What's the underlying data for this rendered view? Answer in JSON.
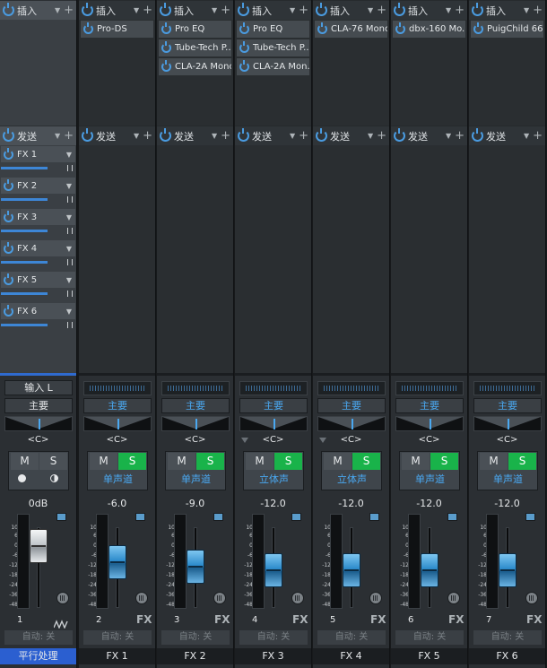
{
  "header_labels": {
    "insert": "插入",
    "send": "发送"
  },
  "scale_labels": [
    "10",
    "6",
    "0",
    "-6",
    "-12",
    "-18",
    "-24",
    "-36",
    "-48"
  ],
  "channels": [
    {
      "id": "ch1",
      "input": "输入 L",
      "output": "主要",
      "pan": "<C>",
      "mute": "M",
      "solo": "S",
      "solo_active": false,
      "route": "",
      "volume": "0dB",
      "number": "1",
      "name": "平行处理",
      "automation": "自动: 关",
      "fx_label": "",
      "fader_level": 1.0,
      "inserts": [],
      "sends": [
        "FX 1",
        "FX 2",
        "FX 3",
        "FX 4",
        "FX 5",
        "FX 6"
      ]
    },
    {
      "id": "ch2",
      "input": "",
      "output": "主要",
      "pan": "<C>",
      "mute": "M",
      "solo": "S",
      "solo_active": true,
      "route": "单声道",
      "volume": "-6.0",
      "number": "2",
      "name": "FX 1",
      "automation": "自动: 关",
      "fx_label": "FX",
      "fader_level": 0.6,
      "inserts": [
        "Pro-DS"
      ],
      "sends": []
    },
    {
      "id": "ch3",
      "input": "",
      "output": "主要",
      "pan": "<C>",
      "mute": "M",
      "solo": "S",
      "solo_active": true,
      "route": "单声道",
      "volume": "-9.0",
      "number": "3",
      "name": "FX 2",
      "automation": "自动: 关",
      "fx_label": "FX",
      "fader_level": 0.5,
      "inserts": [
        "Pro EQ",
        "Tube-Tech P...",
        "CLA-2A Mono"
      ],
      "sends": []
    },
    {
      "id": "ch4",
      "input": "",
      "output": "主要",
      "pan": "<C>",
      "mute": "M",
      "solo": "S",
      "solo_active": true,
      "route": "立体声",
      "volume": "-12.0",
      "number": "4",
      "name": "FX 3",
      "automation": "自动: 关",
      "fx_label": "FX",
      "fader_level": 0.42,
      "inserts": [
        "Pro EQ",
        "Tube-Tech P...",
        "CLA-2A Mon..."
      ],
      "sends": []
    },
    {
      "id": "ch5",
      "input": "",
      "output": "主要",
      "pan": "<C>",
      "mute": "M",
      "solo": "S",
      "solo_active": true,
      "route": "立体声",
      "volume": "-12.0",
      "number": "5",
      "name": "FX 4",
      "automation": "自动: 关",
      "fx_label": "FX",
      "fader_level": 0.42,
      "inserts": [
        "CLA-76 Mono"
      ],
      "sends": []
    },
    {
      "id": "ch6",
      "input": "",
      "output": "主要",
      "pan": "<C>",
      "mute": "M",
      "solo": "S",
      "solo_active": true,
      "route": "单声道",
      "volume": "-12.0",
      "number": "6",
      "name": "FX 5",
      "automation": "自动: 关",
      "fx_label": "FX",
      "fader_level": 0.42,
      "inserts": [
        "dbx-160 Mo..."
      ],
      "sends": []
    },
    {
      "id": "ch7",
      "input": "",
      "output": "主要",
      "pan": "<C>",
      "mute": "M",
      "solo": "S",
      "solo_active": true,
      "route": "单声道",
      "volume": "-12.0",
      "number": "7",
      "name": "FX 6",
      "automation": "自动: 关",
      "fx_label": "FX",
      "fader_level": 0.42,
      "inserts": [
        "PuigChild 66..."
      ],
      "sends": []
    }
  ],
  "colors": {
    "accent": "#4aa8f0",
    "solo_on": "#19b34a",
    "selected_name": "#2b5fd0"
  }
}
